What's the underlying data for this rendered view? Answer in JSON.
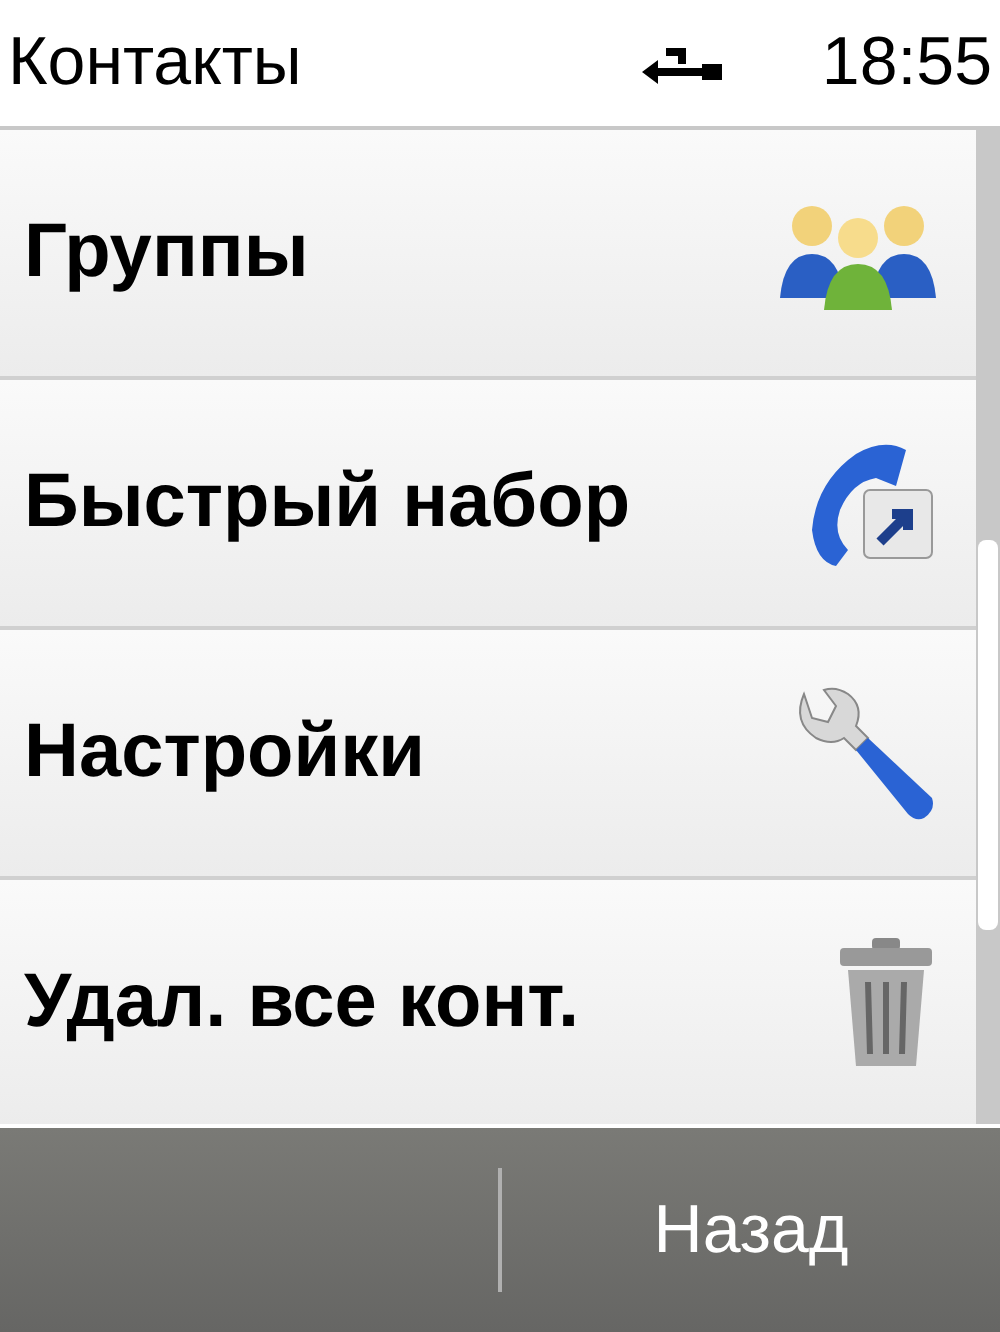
{
  "status_bar": {
    "title": "Контакты",
    "time": "18:55"
  },
  "menu": {
    "items": [
      {
        "label": "Группы",
        "kind": "groups"
      },
      {
        "label": "Быстрый набор",
        "kind": "speed-dial"
      },
      {
        "label": "Настройки",
        "kind": "settings"
      },
      {
        "label": "Удал. все конт.",
        "kind": "delete"
      }
    ]
  },
  "softkeys": {
    "right": "Назад"
  }
}
